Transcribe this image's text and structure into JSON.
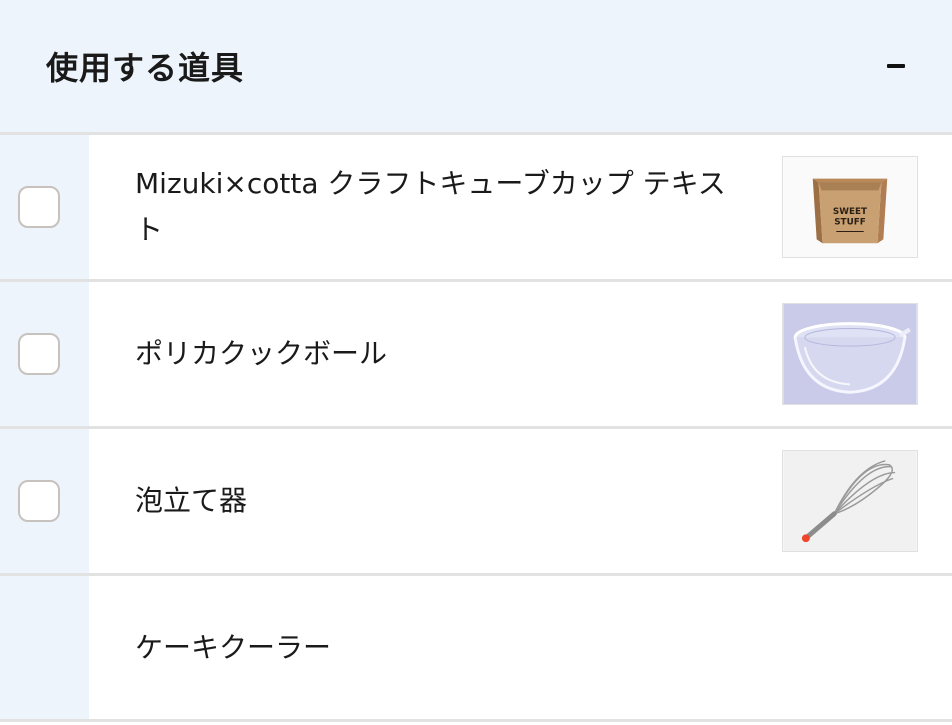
{
  "header": {
    "title": "使用する道具",
    "collapse_icon": "minus-icon"
  },
  "items": [
    {
      "name": "Mizuki×cotta クラフトキューブカップ テキスト",
      "checked": false,
      "image_icon": "craft-cube-cup-image",
      "image_text": "SWEET STUFF"
    },
    {
      "name": "ポリカクックボール",
      "checked": false,
      "image_icon": "mixing-bowl-image"
    },
    {
      "name": "泡立て器",
      "checked": false,
      "image_icon": "whisk-image"
    },
    {
      "name": "ケーキクーラー",
      "checked": false
    }
  ],
  "colors": {
    "sidebar_bg": "#eef4fb",
    "divider": "#e2e2e2",
    "checkbox_border": "#c7c2bd"
  }
}
